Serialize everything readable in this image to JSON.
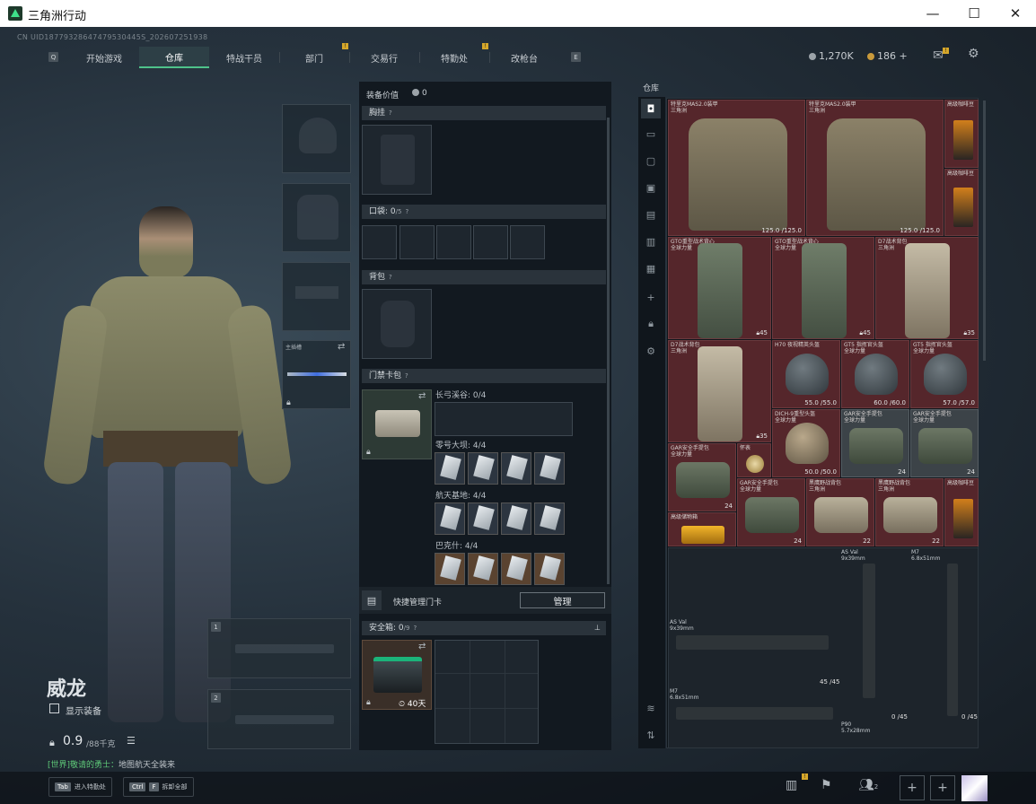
{
  "window": {
    "title": "三角洲行动",
    "min": "—",
    "max": "☐",
    "close": "✕"
  },
  "uid": "CN UID18779328647479530445S_202607251938",
  "nav": {
    "left_key": "Q",
    "right_key": "E",
    "tabs": [
      {
        "label": "开始游戏",
        "active": false,
        "badge": ""
      },
      {
        "label": "仓库",
        "active": true,
        "badge": ""
      },
      {
        "label": "特战干员",
        "active": false,
        "badge": ""
      },
      {
        "label": "部门",
        "active": false,
        "badge": "!"
      },
      {
        "label": "交易行",
        "active": false,
        "badge": ""
      },
      {
        "label": "特勤处",
        "active": false,
        "badge": "!"
      },
      {
        "label": "改枪台",
        "active": false,
        "badge": ""
      }
    ]
  },
  "currency": {
    "hafu": "1,270K",
    "coin": "186",
    "plus": "+"
  },
  "operator": {
    "name": "威龙",
    "show_equipment": "显示装备",
    "weight": "0.9",
    "weight_max": "/88千克"
  },
  "chat": {
    "channel": "[世界]",
    "user": "敬请的勇士：",
    "msg": "地图航天全装来"
  },
  "equipment": {
    "value_label": "装备价值",
    "value": "0",
    "chest": "胸挂",
    "pocket": "口袋",
    "pocket_count": "0",
    "pocket_max": "/5",
    "backpack": "背包",
    "keycard": "门禁卡包",
    "keycard_groups": [
      {
        "label": "长弓溪谷: 0/4",
        "filled": 0
      },
      {
        "label": "零号大坝: 4/4",
        "filled": 4
      },
      {
        "label": "航天基地: 4/4",
        "filled": 4
      },
      {
        "label": "巴克什: 4/4",
        "filled": 4
      }
    ],
    "quick_manage": "快捷管理门卡",
    "manage_btn": "管理",
    "safebox": "安全箱",
    "safebox_count": "0",
    "safebox_max": "/9",
    "safebox_days": "40天",
    "melee_label": "主插槽"
  },
  "slots": {
    "slot1": "1",
    "slot2": "2"
  },
  "stash": {
    "title": "仓库",
    "items": {
      "armor1": {
        "name": "特里克MAS2.0装甲\n三角洲",
        "dur": "125.0 /125.0"
      },
      "armor2": {
        "name": "特里克MAS2.0装甲\n三角洲",
        "dur": "125.0 /125.0"
      },
      "coffee1": {
        "name": "高级咖啡豆"
      },
      "coffee2": {
        "name": "高级咖啡豆"
      },
      "rig1": {
        "name": "GTO重型战术背心\n全球力量",
        "count": "45"
      },
      "rig2": {
        "name": "GTO重型战术背心\n全球力量",
        "count": "45"
      },
      "rig3": {
        "name": "D7战术背包\n三角洲",
        "count": "35"
      },
      "rig4": {
        "name": "D7战术背包\n三角洲",
        "count": "35"
      },
      "helm1": {
        "name": "H70 夜视精英头盔",
        "dur": "55.0 /55.0"
      },
      "helm2": {
        "name": "GT5 指挥官头盔\n全球力量",
        "dur": "60.0 /60.0"
      },
      "helm3": {
        "name": "GT5 指挥官头盔\n全球力量",
        "dur": "57.0 /57.0"
      },
      "helm4": {
        "name": "DICH-9重型头盔\n全球力量",
        "dur": "50.0 /50.0"
      },
      "bag1": {
        "name": "GAR安全手提包\n全球力量",
        "count": "24"
      },
      "bag2": {
        "name": "GAR安全手提包\n全球力量",
        "count": "24"
      },
      "bag3": {
        "name": "GAR安全手提包\n全球力量",
        "count": "24"
      },
      "watch": {
        "name": "怀表"
      },
      "bag4": {
        "name": "GAR安全手提包\n全球力量",
        "count": "24"
      },
      "bag5": {
        "name": "黑鹰野战背包\n三角洲",
        "count": "22"
      },
      "bag6": {
        "name": "黑鹰野战背包\n三角洲",
        "count": "22"
      },
      "coffee3": {
        "name": "高级咖啡豆"
      },
      "goldbox": {
        "name": "高级储物箱"
      },
      "gun1": {
        "name": "AS Val\n9x39mm",
        "ammo": "45 /45"
      },
      "gun2": {
        "name": "AS Val\n9x39mm",
        "ammo": "0 /45"
      },
      "gun3": {
        "name": "M7\n6.8x51mm",
        "ammo": "0 /45"
      },
      "gun4": {
        "name": "M7\n6.8x51mm",
        "ammo": ""
      },
      "gun5": {
        "name": "P90\n5.7x28mm",
        "ammo": ""
      }
    }
  },
  "bottom": {
    "tab_key": "Tab",
    "tab_hint": "进入特勤处",
    "ctrl_key": "Ctrl",
    "f_key": "F",
    "ctrl_hint": "拆卸全部",
    "friends": "2",
    "plus1": "+",
    "plus2": "+"
  },
  "colors": {
    "accent": "#4ec38a",
    "warn": "#d6a72a",
    "stash_red": "#55262b"
  }
}
